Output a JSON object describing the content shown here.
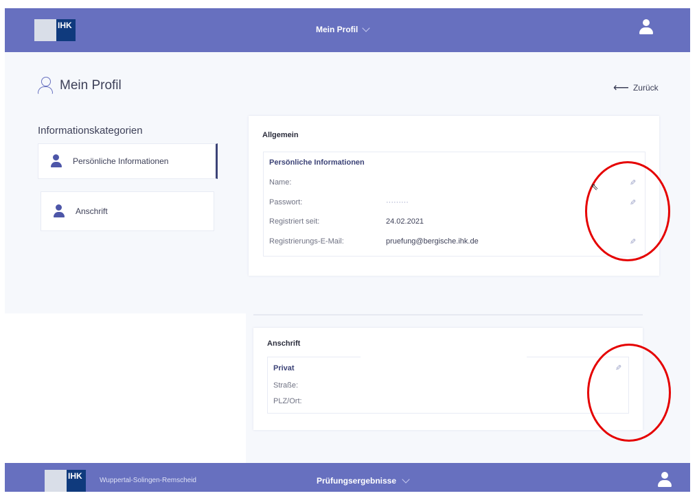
{
  "header": {
    "logo_text": "IHK",
    "title": "Mein Profil"
  },
  "page": {
    "title": "Mein Profil",
    "back_label": "Zurück"
  },
  "sidebar": {
    "heading": "Informationskategorien",
    "items": [
      {
        "label": "Persönliche Informationen",
        "active": true
      },
      {
        "label": "Anschrift",
        "active": false
      }
    ]
  },
  "general": {
    "title": "Allgemein",
    "section_title": "Persönliche Informationen",
    "fields": [
      {
        "label": "Name:",
        "value": ""
      },
      {
        "label": "Passwort:",
        "value": "·········"
      },
      {
        "label": "Registriert seit:",
        "value": "24.02.2021"
      },
      {
        "label": "Registrierungs-E-Mail:",
        "value": "pruefung@bergische.ihk.de"
      }
    ]
  },
  "address": {
    "title": "Anschrift",
    "section_title": "Privat",
    "fields": [
      {
        "label": "Straße:",
        "value": ""
      },
      {
        "label": "PLZ/Ort:",
        "value": ""
      }
    ]
  },
  "footer": {
    "logo_text": "IHK",
    "city": "Wuppertal-Solingen-Remscheid",
    "title": "Prüfungsergebnisse"
  },
  "icons": {
    "edit": "pencil-icon",
    "user": "user-icon",
    "back": "arrow-left-icon"
  },
  "colors": {
    "brand": "#6770bf",
    "annotation": "#e50000",
    "ihk_blue": "#0f3a7d"
  }
}
